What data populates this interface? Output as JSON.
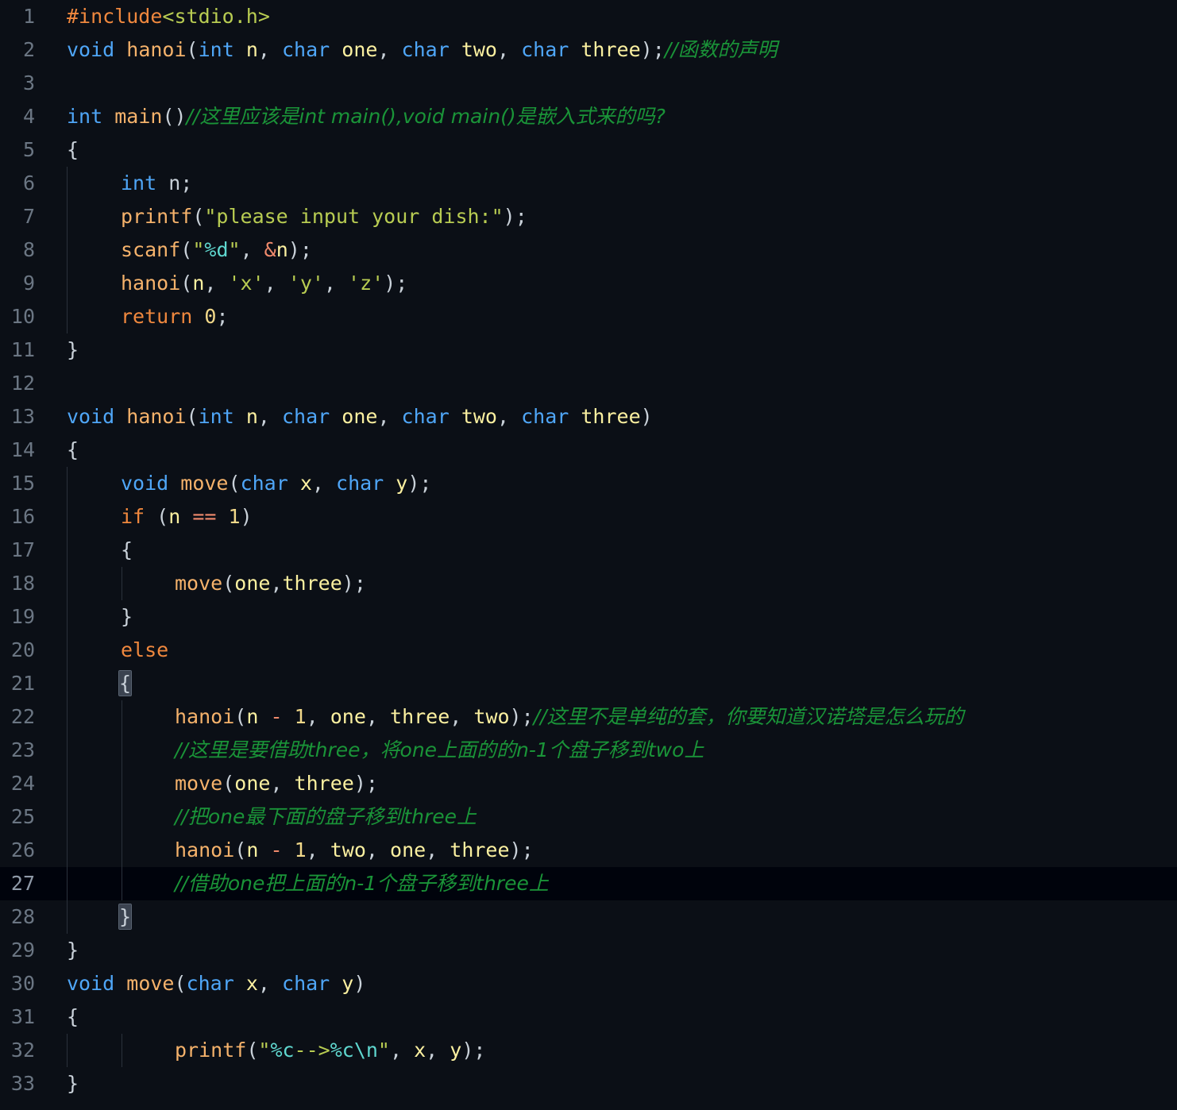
{
  "editor": {
    "language": "C",
    "theme": "dark",
    "background_color": "#0b0f16",
    "active_line_color": "#00030c",
    "line_number_color": "#6b7683",
    "total_lines": 33,
    "active_line": 27,
    "indent_guides_visible": true,
    "bracket_match_lines": [
      21,
      28
    ]
  },
  "colors": {
    "preprocessor": "#f0883e",
    "header": "#b8cc52",
    "type": "#4fa6f7",
    "function": "#f5b26b",
    "identifier": "#fbf0a0",
    "punctuation": "#c9d1d9",
    "string": "#b8cc52",
    "escape": "#5fd7cf",
    "keyword": "#f0883e",
    "number": "#f2d98a",
    "operator": "#f08a6c",
    "comment": "#1a9438"
  },
  "line_numbers": [
    "1",
    "2",
    "3",
    "4",
    "5",
    "6",
    "7",
    "8",
    "9",
    "10",
    "11",
    "12",
    "13",
    "14",
    "15",
    "16",
    "17",
    "18",
    "19",
    "20",
    "21",
    "22",
    "23",
    "24",
    "25",
    "26",
    "27",
    "28",
    "29",
    "30",
    "31",
    "32",
    "33"
  ],
  "code": {
    "l1": {
      "pre": "#include",
      "hdr": "<stdio.h>"
    },
    "l2": {
      "type1": "void",
      "sp1": " ",
      "fn": "hanoi",
      "p1": "(",
      "type2": "int",
      "sp2": " ",
      "v1": "n",
      "p2": ", ",
      "type3": "char",
      "sp3": " ",
      "v2": "one",
      "p3": ", ",
      "type4": "char",
      "sp4": " ",
      "v3": "two",
      "p4": ", ",
      "type5": "char",
      "sp5": " ",
      "v4": "three",
      "p5": ");",
      "cmt": "//函数的声明"
    },
    "l3": {
      "text": ""
    },
    "l4": {
      "type": "int",
      "sp": " ",
      "fn": "main",
      "p": "()",
      "cmt": "//这里应该是int main(),void main()是嵌入式来的吗?"
    },
    "l5": {
      "brace": "{"
    },
    "l6": {
      "type": "int",
      "sp": " ",
      "rest": " n;"
    },
    "l7": {
      "fn": "printf",
      "p1": "(",
      "str": "\"please input your dish:\"",
      "p2": ");"
    },
    "l8": {
      "fn": "scanf",
      "p1": "(",
      "q1": "\"",
      "esc": "%d",
      "q2": "\"",
      "p2": ", ",
      "amp": "&",
      "v": "n",
      "p3": ");"
    },
    "l9": {
      "fn": "hanoi",
      "p1": "(",
      "v": "n",
      "p2": ", ",
      "c1": "'x'",
      "p3": ", ",
      "c2": "'y'",
      "p4": ", ",
      "c3": "'z'",
      "p5": ");"
    },
    "l10": {
      "kw": "return",
      "sp": " ",
      "num": "0",
      "p": ";"
    },
    "l11": {
      "brace": "}"
    },
    "l12": {
      "text": ""
    },
    "l13": {
      "type1": "void",
      "sp1": " ",
      "fn": "hanoi",
      "p1": "(",
      "type2": "int",
      "sp2": " ",
      "v1": "n",
      "p2": ", ",
      "type3": "char",
      "sp3": " ",
      "v2": "one",
      "p3": ", ",
      "type4": "char",
      "sp4": " ",
      "v3": "two",
      "p4": ", ",
      "type5": "char",
      "sp5": " ",
      "v4": "three",
      "p5": ")"
    },
    "l14": {
      "brace": "{"
    },
    "l15": {
      "type1": "void",
      "sp1": " ",
      "fn": "move",
      "p1": "(",
      "type2": "char",
      "sp2": " ",
      "v1": "x",
      "p2": ", ",
      "type3": "char",
      "sp3": " ",
      "v2": "y",
      "p3": ");"
    },
    "l16": {
      "kw": "if",
      "p1": " (",
      "v": "n",
      "sp1": " ",
      "op": "==",
      "sp2": " ",
      "num": "1",
      "p2": ")"
    },
    "l17": {
      "brace": "{"
    },
    "l18": {
      "fn": "move",
      "p1": "(",
      "v1": "one",
      "p2": ",",
      "v2": "three",
      "p3": ");"
    },
    "l19": {
      "brace": "}"
    },
    "l20": {
      "kw": "else"
    },
    "l21": {
      "brace": "{"
    },
    "l22": {
      "fn": "hanoi",
      "p1": "(",
      "v1": "n",
      "sp1": " ",
      "op": "-",
      "sp2": " ",
      "num": "1",
      "p2": ", ",
      "v2": "one",
      "p3": ", ",
      "v3": "three",
      "p4": ", ",
      "v4": "two",
      "p5": ");",
      "cmt": "//这里不是单纯的套，你要知道汉诺塔是怎么玩的"
    },
    "l23": {
      "cmt": "//这里是要借助three，将one上面的的n-1个盘子移到two上"
    },
    "l24": {
      "fn": "move",
      "p1": "(",
      "v1": "one",
      "p2": ", ",
      "v2": "three",
      "p3": ");"
    },
    "l25": {
      "cmt": "//把one最下面的盘子移到three上"
    },
    "l26": {
      "fn": "hanoi",
      "p1": "(",
      "v1": "n",
      "sp1": " ",
      "op": "-",
      "sp2": " ",
      "num": "1",
      "p2": ", ",
      "v2": "two",
      "p3": ", ",
      "v3": "one",
      "p4": ", ",
      "v4": "three",
      "p5": ");"
    },
    "l27": {
      "cmt": "//借助one把上面的n-1个盘子移到three上"
    },
    "l28": {
      "brace": "}"
    },
    "l29": {
      "brace": "}"
    },
    "l30": {
      "type1": "void",
      "sp1": " ",
      "fn": "move",
      "p1": "(",
      "type2": "char",
      "sp2": " ",
      "v1": "x",
      "p2": ", ",
      "type3": "char",
      "sp3": " ",
      "v2": "y",
      "p3": ")"
    },
    "l31": {
      "brace": "{"
    },
    "l32": {
      "fn": "printf",
      "p1": "(",
      "q1": "\"",
      "e1": "%c",
      "arrow": "-->",
      "e2": "%c",
      "e3": "\\n",
      "q2": "\"",
      "p2": ", ",
      "v1": "x",
      "p3": ", ",
      "v2": "y",
      "p4": ");"
    },
    "l33": {
      "brace": "}"
    }
  }
}
